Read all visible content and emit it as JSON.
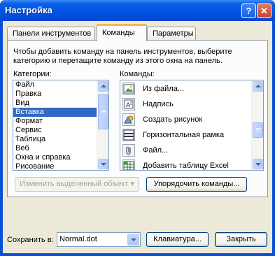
{
  "window": {
    "title": "Настройка"
  },
  "titlebar": {
    "help_glyph": "?",
    "close_glyph": "✕"
  },
  "tabs": [
    {
      "label": "Панели инструментов"
    },
    {
      "label": "Команды"
    },
    {
      "label": "Параметры"
    }
  ],
  "commands_tab": {
    "info_text": "Чтобы добавить команду на панель инструментов, выберите категорию и перетащите команду из этого окна на панель.",
    "categories_label": "Категории:",
    "commands_label": "Команды:",
    "categories": [
      "Файл",
      "Правка",
      "Вид",
      "Вставка",
      "Формат",
      "Сервис",
      "Таблица",
      "Веб",
      "Окна и справка",
      "Рисование"
    ],
    "selected_category": "Вставка",
    "commands": [
      {
        "label": "Из файла...",
        "icon": "picture-from-file-icon"
      },
      {
        "label": "Надпись",
        "icon": "text-box-icon"
      },
      {
        "label": "Создать рисунок",
        "icon": "create-drawing-icon"
      },
      {
        "label": "Горизонтальная рамка",
        "icon": "horizontal-frame-icon"
      },
      {
        "label": "Файл...",
        "icon": "paperclip-icon"
      },
      {
        "label": "Добавить таблицу Excel",
        "icon": "excel-table-icon"
      }
    ],
    "modify_selection_label": "Изменить выделенный объект ▾",
    "rearrange_label": "Упорядочить команды..."
  },
  "footer": {
    "save_in_label": "Сохранить в:",
    "save_in_value": "Normal.dot",
    "keyboard_label": "Клавиатура...",
    "close_label": "Закрыть"
  },
  "colors": {
    "titlebar": "#0054e3",
    "selection": "#316ac5",
    "dialog_bg": "#ece9d8"
  }
}
